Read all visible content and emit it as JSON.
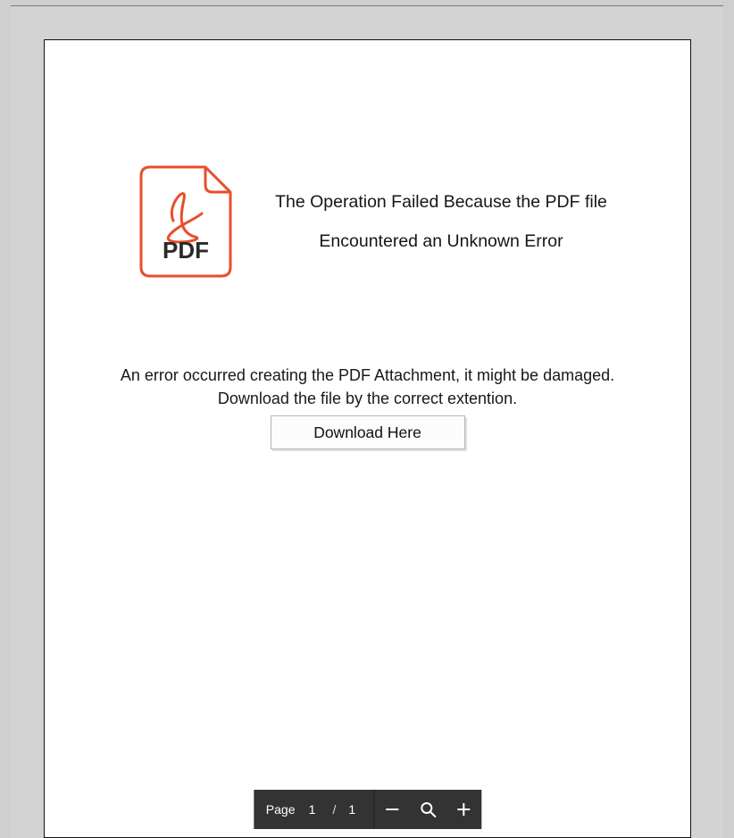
{
  "content": {
    "icon_label": "PDF",
    "headline_line1": "The Operation Failed Because the PDF file",
    "headline_line2": "Encountered an Unknown Error",
    "sub_line1": "An error occurred creating the PDF Attachment, it might be damaged.",
    "sub_line2": "Download the file by the correct extention.",
    "download_label": "Download Here"
  },
  "toolbar": {
    "page_label": "Page",
    "current_page": "1",
    "separator": "/",
    "total_pages": "1"
  },
  "colors": {
    "pdf_accent": "#e94e2b",
    "toolbar_bg": "#333333"
  }
}
